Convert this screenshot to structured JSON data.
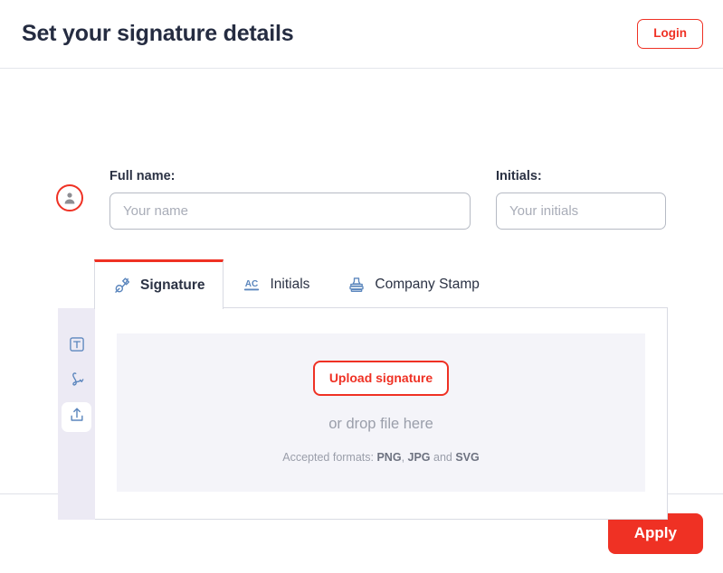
{
  "header": {
    "title": "Set your signature details",
    "login_label": "Login"
  },
  "form": {
    "avatar_icon": "user-avatar-icon",
    "fullname": {
      "label": "Full name:",
      "placeholder": "Your name",
      "value": ""
    },
    "initials": {
      "label": "Initials:",
      "placeholder": "Your initials",
      "value": ""
    }
  },
  "tabs": [
    {
      "label": "Signature",
      "icon": "pen-nib-icon",
      "active": true
    },
    {
      "label": "Initials",
      "icon": "ac-initials-icon",
      "active": false
    },
    {
      "label": "Company Stamp",
      "icon": "stamp-icon",
      "active": false
    }
  ],
  "sidebar": {
    "items": [
      {
        "name": "type-text-icon",
        "active": false
      },
      {
        "name": "draw-signature-icon",
        "active": false
      },
      {
        "name": "upload-icon",
        "active": true
      }
    ]
  },
  "dropzone": {
    "upload_label": "Upload signature",
    "drop_text": "or drop file here",
    "formats_prefix": "Accepted formats: ",
    "format_1": "PNG",
    "formats_sep": ", ",
    "format_2": "JPG",
    "formats_and": " and ",
    "format_3": "SVG"
  },
  "footer": {
    "apply_label": "Apply"
  },
  "colors": {
    "accent_red": "#ef3124",
    "title_navy": "#252c41",
    "icon_blue": "#5b86bd",
    "sidebar_bg": "#eceaf4",
    "dropzone_bg": "#f4f4f9",
    "placeholder_gray": "#a9adb8"
  }
}
